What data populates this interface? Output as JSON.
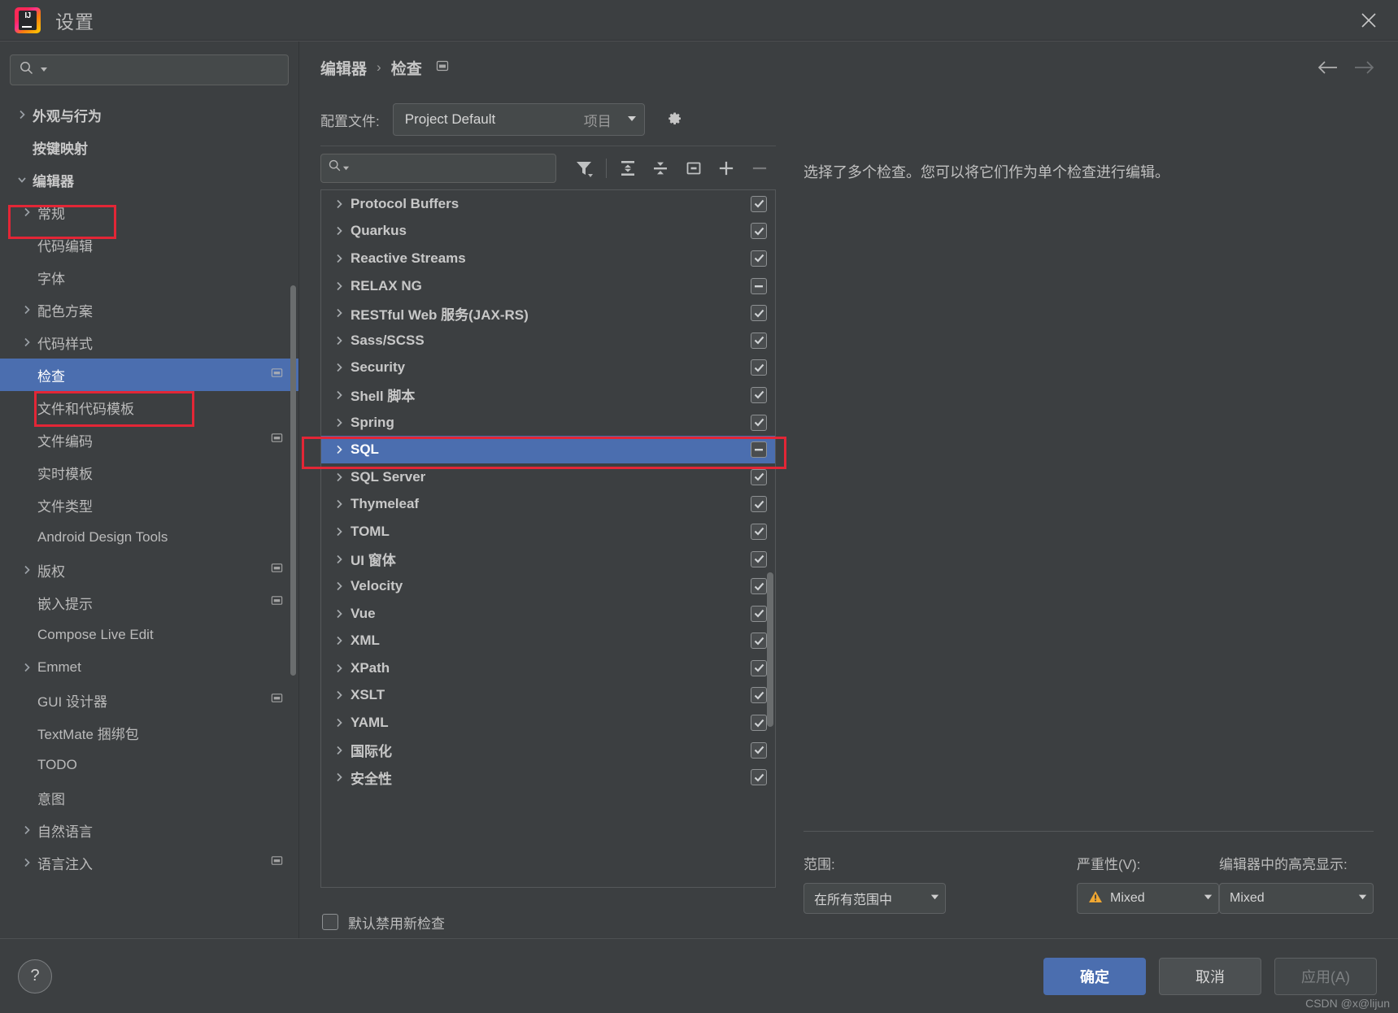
{
  "window": {
    "title": "设置",
    "logo_text": "IJ",
    "close_icon": "close-icon"
  },
  "sidebar": {
    "search_placeholder": "",
    "search_value": "",
    "items": [
      {
        "label": "外观与行为",
        "level": 0,
        "arrow": "chevron-right",
        "bold": true,
        "selected": false,
        "project": false
      },
      {
        "label": "按键映射",
        "level": 0,
        "arrow": "none",
        "bold": true,
        "selected": false,
        "project": false
      },
      {
        "label": "编辑器",
        "level": 0,
        "arrow": "chevron-down",
        "bold": true,
        "selected": false,
        "project": false
      },
      {
        "label": "常规",
        "level": 1,
        "arrow": "chevron-right",
        "bold": false,
        "selected": false,
        "project": false
      },
      {
        "label": "代码编辑",
        "level": 1,
        "arrow": "none",
        "bold": false,
        "selected": false,
        "project": false
      },
      {
        "label": "字体",
        "level": 1,
        "arrow": "none",
        "bold": false,
        "selected": false,
        "project": false
      },
      {
        "label": "配色方案",
        "level": 1,
        "arrow": "chevron-right",
        "bold": false,
        "selected": false,
        "project": false
      },
      {
        "label": "代码样式",
        "level": 1,
        "arrow": "chevron-right",
        "bold": false,
        "selected": false,
        "project": false
      },
      {
        "label": "检查",
        "level": 1,
        "arrow": "none",
        "bold": false,
        "selected": true,
        "project": true
      },
      {
        "label": "文件和代码模板",
        "level": 1,
        "arrow": "none",
        "bold": false,
        "selected": false,
        "project": false
      },
      {
        "label": "文件编码",
        "level": 1,
        "arrow": "none",
        "bold": false,
        "selected": false,
        "project": true
      },
      {
        "label": "实时模板",
        "level": 1,
        "arrow": "none",
        "bold": false,
        "selected": false,
        "project": false
      },
      {
        "label": "文件类型",
        "level": 1,
        "arrow": "none",
        "bold": false,
        "selected": false,
        "project": false
      },
      {
        "label": "Android Design Tools",
        "level": 1,
        "arrow": "none",
        "bold": false,
        "selected": false,
        "project": false
      },
      {
        "label": "版权",
        "level": 1,
        "arrow": "chevron-right",
        "bold": false,
        "selected": false,
        "project": true
      },
      {
        "label": "嵌入提示",
        "level": 1,
        "arrow": "none",
        "bold": false,
        "selected": false,
        "project": true
      },
      {
        "label": "Compose Live Edit",
        "level": 1,
        "arrow": "none",
        "bold": false,
        "selected": false,
        "project": false
      },
      {
        "label": "Emmet",
        "level": 1,
        "arrow": "chevron-right",
        "bold": false,
        "selected": false,
        "project": false
      },
      {
        "label": "GUI 设计器",
        "level": 1,
        "arrow": "none",
        "bold": false,
        "selected": false,
        "project": true
      },
      {
        "label": "TextMate 捆绑包",
        "level": 1,
        "arrow": "none",
        "bold": false,
        "selected": false,
        "project": false
      },
      {
        "label": "TODO",
        "level": 1,
        "arrow": "none",
        "bold": false,
        "selected": false,
        "project": false
      },
      {
        "label": "意图",
        "level": 1,
        "arrow": "none",
        "bold": false,
        "selected": false,
        "project": false
      },
      {
        "label": "自然语言",
        "level": 1,
        "arrow": "chevron-right",
        "bold": false,
        "selected": false,
        "project": false
      },
      {
        "label": "语言注入",
        "level": 1,
        "arrow": "chevron-right",
        "bold": false,
        "selected": false,
        "project": true
      }
    ]
  },
  "breadcrumb": {
    "parent": "编辑器",
    "separator": "›",
    "current": "检查",
    "project_icon": "project-scope-icon",
    "back_icon": "arrow-left-icon",
    "forward_icon": "arrow-right-icon"
  },
  "profile": {
    "label": "配置文件:",
    "value": "Project Default",
    "value_suffix": "项目",
    "gear_icon": "gear-icon"
  },
  "toolbar": {
    "search_placeholder": "",
    "search_value": "",
    "buttons": [
      {
        "name": "filter-icon",
        "title": "筛选"
      },
      {
        "name": "expand-all-icon",
        "title": "全部展开"
      },
      {
        "name": "collapse-all-icon",
        "title": "全部折叠"
      },
      {
        "name": "reset-icon",
        "title": "重置"
      },
      {
        "name": "add-icon",
        "title": "添加"
      },
      {
        "name": "remove-icon",
        "title": "移除"
      }
    ]
  },
  "inspections": {
    "rows": [
      {
        "label": "Protocol Buffers",
        "state": "checked",
        "selected": false
      },
      {
        "label": "Quarkus",
        "state": "checked",
        "selected": false
      },
      {
        "label": "Reactive Streams",
        "state": "checked",
        "selected": false
      },
      {
        "label": "RELAX NG",
        "state": "partial",
        "selected": false
      },
      {
        "label": "RESTful Web 服务(JAX-RS)",
        "state": "checked",
        "selected": false
      },
      {
        "label": "Sass/SCSS",
        "state": "checked",
        "selected": false
      },
      {
        "label": "Security",
        "state": "checked",
        "selected": false
      },
      {
        "label": "Shell 脚本",
        "state": "checked",
        "selected": false
      },
      {
        "label": "Spring",
        "state": "checked",
        "selected": false
      },
      {
        "label": "SQL",
        "state": "partial",
        "selected": true
      },
      {
        "label": "SQL Server",
        "state": "checked",
        "selected": false
      },
      {
        "label": "Thymeleaf",
        "state": "checked",
        "selected": false
      },
      {
        "label": "TOML",
        "state": "checked",
        "selected": false
      },
      {
        "label": "UI 窗体",
        "state": "checked",
        "selected": false
      },
      {
        "label": "Velocity",
        "state": "checked",
        "selected": false
      },
      {
        "label": "Vue",
        "state": "checked",
        "selected": false
      },
      {
        "label": "XML",
        "state": "checked",
        "selected": false
      },
      {
        "label": "XPath",
        "state": "checked",
        "selected": false
      },
      {
        "label": "XSLT",
        "state": "checked",
        "selected": false
      },
      {
        "label": "YAML",
        "state": "checked",
        "selected": false
      },
      {
        "label": "国际化",
        "state": "checked",
        "selected": false
      },
      {
        "label": "安全性",
        "state": "checked",
        "selected": false
      }
    ],
    "disable_new_label": "默认禁用新检查",
    "disable_new_checked": false
  },
  "detail": {
    "message": "选择了多个检查。您可以将它们作为单个检查进行编辑。",
    "scope_label": "范围:",
    "scope_value": "在所有范围中",
    "severity_label": "严重性(V):",
    "severity_value": "Mixed",
    "highlight_label": "编辑器中的高亮显示:",
    "highlight_value": "Mixed"
  },
  "footer": {
    "help_label": "?",
    "ok_label": "确定",
    "cancel_label": "取消",
    "apply_label": "应用(A)",
    "watermark": "CSDN @x@lijun"
  },
  "colors": {
    "accent": "#4b6eaf",
    "highlight_box": "#e32636",
    "background": "#3c3f41",
    "panel": "#45494a",
    "text": "#bbbbbb"
  }
}
